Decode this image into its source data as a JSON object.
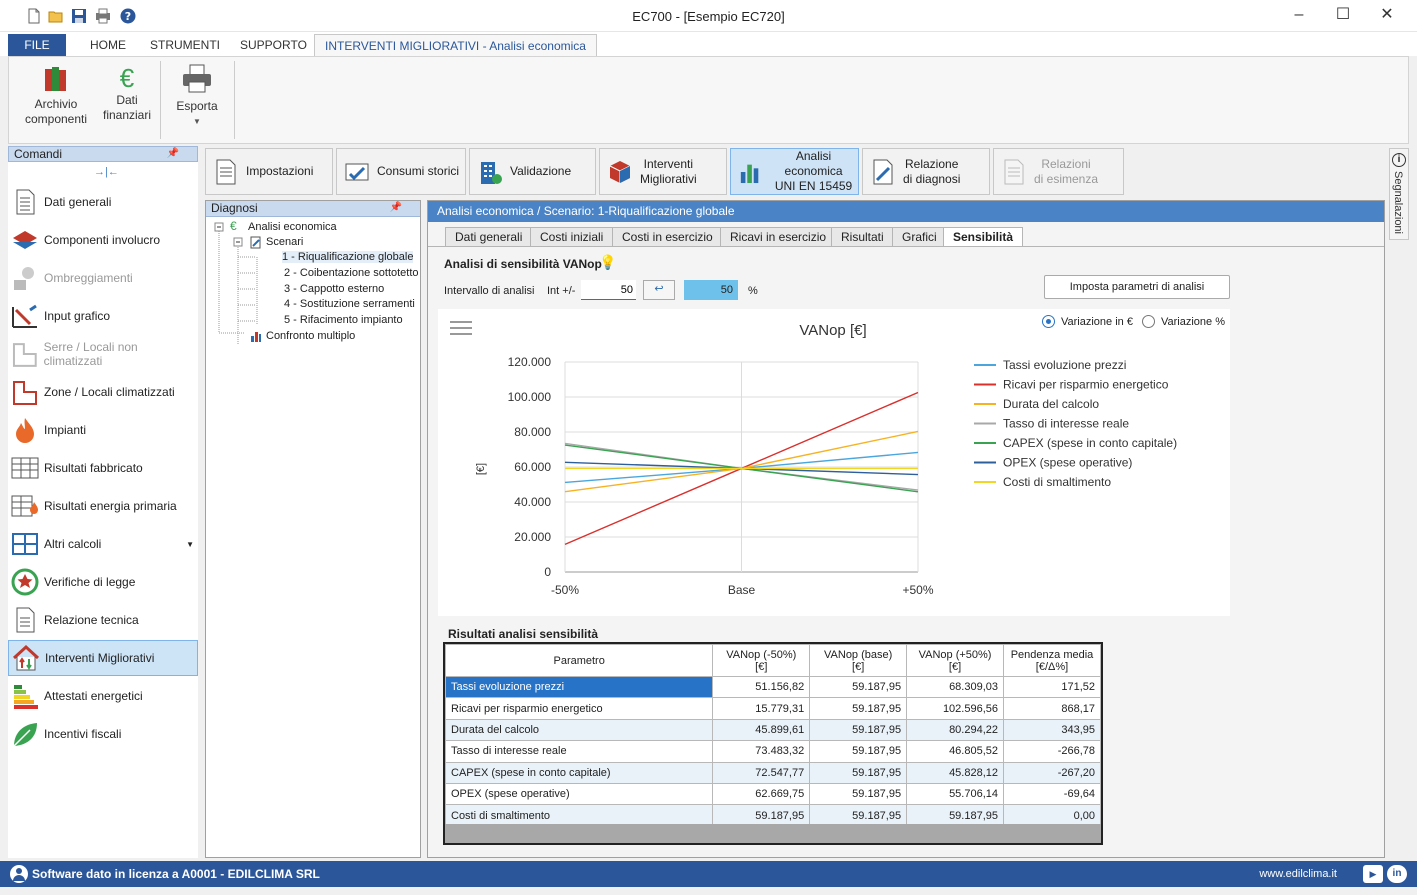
{
  "window": {
    "title": "EC700 - [Esempio EC720]",
    "minimize": "–",
    "maximize": "☐",
    "close": "✕"
  },
  "ribbon_tabs": [
    "FILE",
    "HOME",
    "STRUMENTI",
    "SUPPORTO",
    "INTERVENTI MIGLIORATIVI - Analisi economica"
  ],
  "ribbon": {
    "archivio": [
      "Archivio",
      "componenti"
    ],
    "dati_finanziari": [
      "Dati",
      "finanziari"
    ],
    "esporta": "Esporta"
  },
  "left_panel": {
    "header": "Comandi",
    "items": [
      "Dati generali",
      "Componenti involucro",
      "Ombreggiamenti",
      "Input grafico",
      "Serre / Locali non climatizzati",
      "Zone / Locali climatizzati",
      "Impianti",
      "Risultati fabbricato",
      "Risultati energia primaria",
      "Altri calcoli",
      "Verifiche di legge",
      "Relazione tecnica",
      "Interventi Migliorativi",
      "Attestati energetici",
      "Incentivi fiscali"
    ]
  },
  "main_tabs": [
    {
      "l1": "Impostazioni",
      "l2": ""
    },
    {
      "l1": "Consumi storici",
      "l2": ""
    },
    {
      "l1": "Validazione",
      "l2": ""
    },
    {
      "l1": "Interventi",
      "l2": "Migliorativi"
    },
    {
      "l1": "Analisi economica",
      "l2": "UNI EN 15459"
    },
    {
      "l1": "Relazione",
      "l2": "di diagnosi"
    },
    {
      "l1": "Relazioni",
      "l2": "di esimenza"
    }
  ],
  "diag": {
    "header": "Diagnosi",
    "root": "Analisi economica",
    "scenari": "Scenari",
    "items": [
      "1 - Riqualificazione globale",
      "2 - Coibentazione sottotetto",
      "3 - Cappotto esterno",
      "4 - Sostituzione serramenti",
      "5 - Rifacimento impianto"
    ],
    "confronto": "Confronto multiplo"
  },
  "content": {
    "header": "Analisi economica / Scenario: 1-Riqualificazione globale",
    "subtabs": [
      "Dati generali",
      "Costi iniziali",
      "Costi in esercizio",
      "Ricavi in esercizio",
      "Risultati",
      "Grafici",
      "Sensibilità"
    ],
    "section_title": "Analisi di sensibilità VANop",
    "intervallo_label": "Intervallo di analisi",
    "int_label": "Int +/-",
    "int_value": "50",
    "pct_value": "50",
    "pct_unit": "%",
    "imposta_button": "Imposta parametri di analisi",
    "radio_euro": "Variazione in €",
    "radio_pct": "Variazione %"
  },
  "chart_data": {
    "type": "line",
    "title": "VANop [€]",
    "ylabel": "[€]",
    "xlabel": "",
    "categories": [
      "-50%",
      "Base",
      "+50%"
    ],
    "yticks": [
      "0",
      "20.000",
      "40.000",
      "60.000",
      "80.000",
      "100.000",
      "120.000"
    ],
    "ylim": [
      0,
      120000
    ],
    "legend_position": "right",
    "series": [
      {
        "name": "Tassi evoluzione prezzi",
        "color": "#4aa6dd",
        "values": [
          51156.82,
          59187.95,
          68309.03
        ]
      },
      {
        "name": "Ricavi per risparmio energetico",
        "color": "#d9302c",
        "values": [
          15779.31,
          59187.95,
          102596.56
        ]
      },
      {
        "name": "Durata del calcolo",
        "color": "#f5b324",
        "values": [
          45899.61,
          59187.95,
          80294.22
        ]
      },
      {
        "name": "Tasso di interesse reale",
        "color": "#a8a8a8",
        "values": [
          73483.32,
          59187.95,
          46805.52
        ]
      },
      {
        "name": "CAPEX (spese in conto capitale)",
        "color": "#3aa352",
        "values": [
          72547.77,
          59187.95,
          45828.12
        ]
      },
      {
        "name": "OPEX (spese operative)",
        "color": "#2f5f9a",
        "values": [
          62669.75,
          59187.95,
          55706.14
        ]
      },
      {
        "name": "Costi di smaltimento",
        "color": "#f2d624",
        "values": [
          59187.95,
          59187.95,
          59187.95
        ]
      }
    ]
  },
  "results": {
    "title": "Risultati analisi sensibilità",
    "headers": [
      [
        "Parametro",
        ""
      ],
      [
        "VANop (-50%)",
        "[€]"
      ],
      [
        "VANop (base)",
        "[€]"
      ],
      [
        "VANop (+50%)",
        "[€]"
      ],
      [
        "Pendenza media",
        "[€/Δ%]"
      ]
    ],
    "rows": [
      [
        "Tassi evoluzione prezzi",
        "51.156,82",
        "59.187,95",
        "68.309,03",
        "171,52"
      ],
      [
        "Ricavi per risparmio energetico",
        "15.779,31",
        "59.187,95",
        "102.596,56",
        "868,17"
      ],
      [
        "Durata del calcolo",
        "45.899,61",
        "59.187,95",
        "80.294,22",
        "343,95"
      ],
      [
        "Tasso di interesse reale",
        "73.483,32",
        "59.187,95",
        "46.805,52",
        "-266,78"
      ],
      [
        "CAPEX (spese in conto capitale)",
        "72.547,77",
        "59.187,95",
        "45.828,12",
        "-267,20"
      ],
      [
        "OPEX (spese operative)",
        "62.669,75",
        "59.187,95",
        "55.706,14",
        "-69,64"
      ],
      [
        "Costi di smaltimento",
        "59.187,95",
        "59.187,95",
        "59.187,95",
        "0,00"
      ]
    ]
  },
  "side_bar": "Segnalazioni",
  "status": {
    "license": "Software dato in licenza a A0001 - EDILCLIMA SRL",
    "website": "www.edilclima.it"
  }
}
